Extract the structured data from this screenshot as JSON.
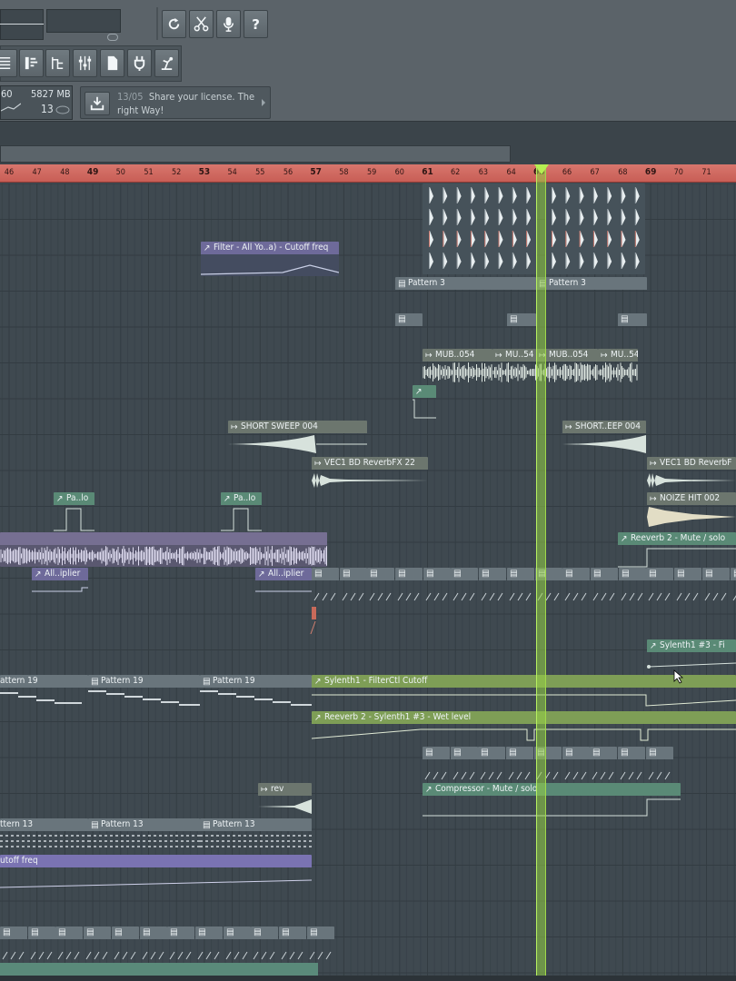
{
  "toolbar": {
    "buttons_row1": [
      {
        "name": "reset-icon",
        "glyph": "↻"
      },
      {
        "name": "scissors-icon",
        "glyph": "✂"
      },
      {
        "name": "microphone-icon",
        "glyph": "mic"
      },
      {
        "name": "help-icon",
        "glyph": "?"
      }
    ],
    "buttons_row2": [
      {
        "name": "playlist-icon"
      },
      {
        "name": "piano-roll-icon"
      },
      {
        "name": "channel-rack-icon"
      },
      {
        "name": "mixer-icon"
      },
      {
        "name": "browser-icon"
      },
      {
        "name": "plugin-icon"
      },
      {
        "name": "project-info-icon"
      }
    ],
    "cpu_value": "60",
    "memory": "5827 MB",
    "polyphony": "13",
    "hint": {
      "date": "13/05",
      "text": "Share your license. The right Way!"
    }
  },
  "ruler": {
    "bars": [
      "46",
      "47",
      "48",
      "49",
      "50",
      "51",
      "52",
      "53",
      "54",
      "55",
      "56",
      "57",
      "58",
      "59",
      "60",
      "61",
      "62",
      "63",
      "64",
      "65",
      "66",
      "67",
      "68",
      "69",
      "70",
      "71"
    ],
    "major": [
      "49",
      "53",
      "57",
      "61",
      "65",
      "69"
    ]
  },
  "colors": {
    "ruler": "#c85e56",
    "playhead": "#9fd84a",
    "grid_bg": "#3f4950"
  },
  "clips": {
    "filter_all": "Filter - All Yo..a) - Cutoff freq",
    "pattern3_a": "Pattern 3",
    "pattern3_b": "Pattern 3",
    "mub_a": "MUB..054",
    "mub_b": "MU..54",
    "mub_c": "MUB..054",
    "mub_d": "MU..54",
    "short_sweep_a": "SHORT SWEEP 004",
    "short_sweep_b": "SHORT..EEP 004",
    "vec1_a": "VEC1 BD ReverbFX 22",
    "vec1_b": "VEC1 BD ReverbF",
    "pa_lo_a": "Pa..lo",
    "pa_lo_b": "Pa..lo",
    "noize": "NOIZE HIT 002",
    "reeverb_mute": "Reeverb 2 - Mute / solo",
    "all_iplier_a": "All..iplier",
    "all_iplier_b": "All..iplier",
    "sylenth_fi": "Sylenth1 #3 - Fi",
    "pattern19_a": "attern 19",
    "pattern19_b": "Pattern 19",
    "pattern19_c": "Pattern 19",
    "sylenth_cutoff": "Sylenth1 - FilterCtl Cutoff",
    "reeverb_wet": "Reeverb 2 - Sylenth1 #3 - Wet level",
    "rev": "rev",
    "compressor": "Compressor - Mute / solo",
    "pattern13_a": "ttern 13",
    "pattern13_b": "Pattern 13",
    "pattern13_c": "Pattern 13",
    "cutoff_freq": "utoff freq"
  }
}
